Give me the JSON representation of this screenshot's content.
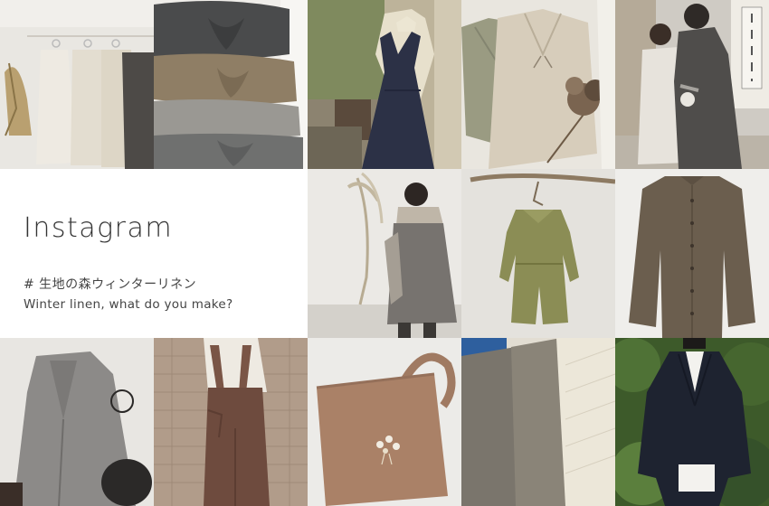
{
  "intro": {
    "title": "Instagram",
    "hashtag": "# 生地の森ウィンターリネン",
    "subtitle": "Winter linen, what do you make?"
  },
  "photos": [
    {
      "name": "photo-linen-shirts-on-rack",
      "row": 1,
      "col": 1
    },
    {
      "name": "photo-knotted-headbands",
      "row": 1,
      "col": 2
    },
    {
      "name": "photo-navy-jumper-dress",
      "row": 1,
      "col": 3
    },
    {
      "name": "photo-sage-and-beige-garments",
      "row": 1,
      "col": 4
    },
    {
      "name": "photo-mother-and-child-shrine",
      "row": 1,
      "col": 5
    },
    {
      "name": "photo-child-grey-coat",
      "row": 2,
      "col": 3
    },
    {
      "name": "photo-green-child-romper",
      "row": 2,
      "col": 4
    },
    {
      "name": "photo-brown-button-shirt",
      "row": 2,
      "col": 5
    },
    {
      "name": "photo-grey-wool-coat",
      "row": 3,
      "col": 1
    },
    {
      "name": "photo-brown-overalls",
      "row": 3,
      "col": 2
    },
    {
      "name": "photo-embroidered-tote-bag",
      "row": 3,
      "col": 3
    },
    {
      "name": "photo-linen-quilted-jacket",
      "row": 3,
      "col": 4
    },
    {
      "name": "photo-navy-blazer-outdoors",
      "row": 3,
      "col": 5
    }
  ],
  "colors": {
    "text": "#333333",
    "background": "#ffffff"
  }
}
